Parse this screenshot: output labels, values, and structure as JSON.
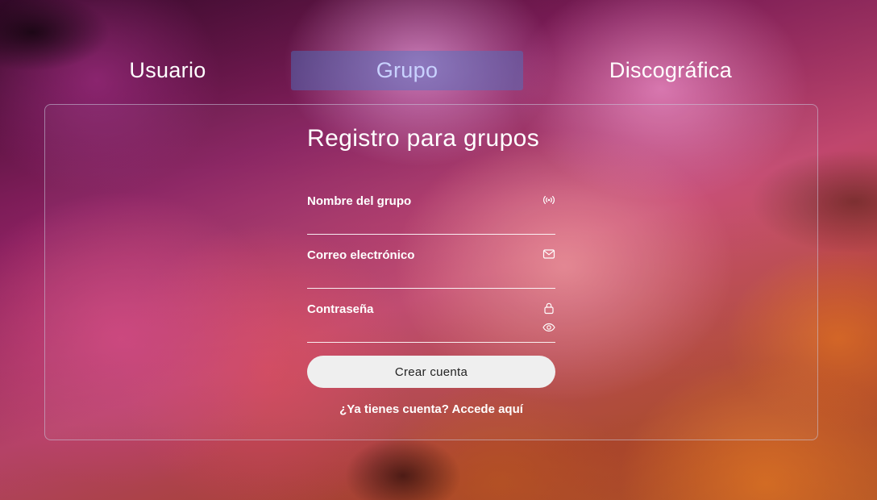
{
  "tabs": {
    "user_label": "Usuario",
    "group_label": "Grupo",
    "label_label": "Discográfica",
    "active": "Grupo"
  },
  "form": {
    "title": "Registro para grupos",
    "fields": [
      {
        "label": "Nombre del grupo",
        "icon": "broadcast-icon",
        "value": ""
      },
      {
        "label": "Correo electrónico",
        "icon": "envelope-icon",
        "value": ""
      },
      {
        "label": "Contraseña",
        "icon": "lock-icon",
        "secondary_icon": "eye-icon",
        "value": ""
      }
    ],
    "submit_label": "Crear cuenta",
    "login_link": "¿Ya tienes cuenta? Accede aquí"
  },
  "colors": {
    "active_tab_bg": "#4678c8",
    "active_tab_text": "#c9d2ff",
    "button_bg": "#efefef",
    "card_border": "#c8c8dc"
  }
}
